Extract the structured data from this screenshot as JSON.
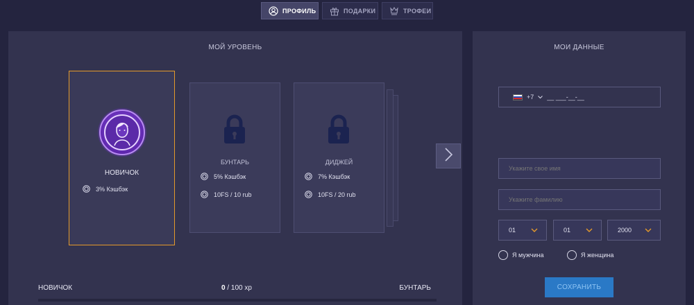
{
  "tabs": [
    {
      "label": "ПРОФИЛЬ",
      "icon": "user-circle-icon",
      "active": true
    },
    {
      "label": "ПОДАРКИ",
      "icon": "gift-icon",
      "active": false
    },
    {
      "label": "ТРОФЕИ",
      "icon": "trophy-icon",
      "active": false
    }
  ],
  "level_panel": {
    "title": "МОЙ УРОВЕНЬ",
    "cards": [
      {
        "name": "НОВИЧОК",
        "perks": [
          "3% Кэшбэк"
        ]
      },
      {
        "name": "БУНТАРЬ",
        "perks": [
          "5% Кэшбэк",
          "10FS / 10 rub"
        ]
      },
      {
        "name": "ДИДЖЕЙ",
        "perks": [
          "7% Кэшбэк",
          "10FS / 20 rub"
        ]
      }
    ],
    "progress": {
      "current_level": "НОВИЧОК",
      "next_level": "БУНТАРЬ",
      "xp_current": "0",
      "xp_total": " / 100 xp",
      "fraction": 0
    }
  },
  "data_panel": {
    "title": "МОИ ДАННЫЕ",
    "phone": {
      "code": "+7",
      "mask": "__ ___-__-__"
    },
    "first_name_placeholder": "Укажите свое имя",
    "last_name_placeholder": "Укажите фамилию",
    "birth_day": "01",
    "birth_month": "01",
    "birth_year": "2000",
    "gender_male": "Я мужчина",
    "gender_female": "Я женщина",
    "save_label": "СОХРАНИТЬ"
  },
  "colors": {
    "accent_orange": "#e69a2a",
    "save_blue": "#2a79c6",
    "avatar_purple": "#7b3fd0",
    "lock_navy": "#1b2350"
  }
}
